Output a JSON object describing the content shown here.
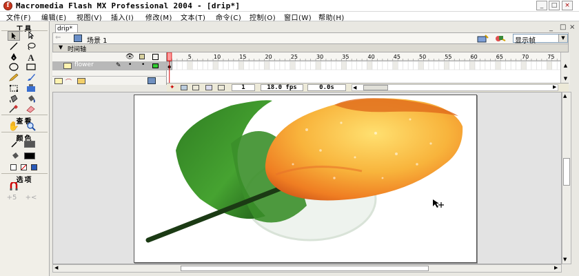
{
  "window": {
    "title": "Macromedia Flash MX Professional 2004 - [drip*]",
    "logo_glyph": "f",
    "minimize_glyph": "_",
    "restore_glyph": "□",
    "close_glyph": "×"
  },
  "menu": [
    "文件(F)",
    "编辑(E)",
    "视图(V)",
    "插入(I)",
    "修改(M)",
    "文本(T)",
    "命令(C)",
    "控制(O)",
    "窗口(W)",
    "帮助(H)"
  ],
  "tools_panel": {
    "title": "工具",
    "view_label": "查看",
    "colors_label": "颜色",
    "options_label": "选项",
    "icons": [
      "arrow-icon",
      "subselect-icon",
      "line-icon",
      "lasso-icon",
      "pen-icon",
      "text-icon",
      "oval-icon",
      "rectangle-icon",
      "pencil-icon",
      "brush-icon",
      "free-transform-icon",
      "fill-transform-icon",
      "ink-bottle-icon",
      "paint-bucket-icon",
      "eyedropper-icon",
      "eraser-icon",
      "hand-icon",
      "zoom-icon",
      "stroke-color-icon",
      "fill-color-icon",
      "snap-icon",
      "smooth-icon",
      "straighten-icon"
    ]
  },
  "document": {
    "tab": "drip*",
    "scene_label": "场景 1",
    "view_dropdown": "显示帧",
    "stage_bg": "#ffffff"
  },
  "timeline": {
    "header": "时间轴",
    "frame_numbers": [
      "1",
      "5",
      "10",
      "15",
      "20",
      "25",
      "30",
      "35",
      "40",
      "45",
      "50",
      "55",
      "60",
      "65",
      "70",
      "75"
    ],
    "layers": [
      {
        "name": "flower",
        "outline_color": "#33cc33"
      }
    ],
    "current_frame": "1",
    "frame_rate": "18.0 fps",
    "elapsed": "0.0s"
  },
  "colors": {
    "accent_red": "#d40000",
    "panel_bg": "#f1efe8",
    "selection_blue": "#316ac5"
  }
}
